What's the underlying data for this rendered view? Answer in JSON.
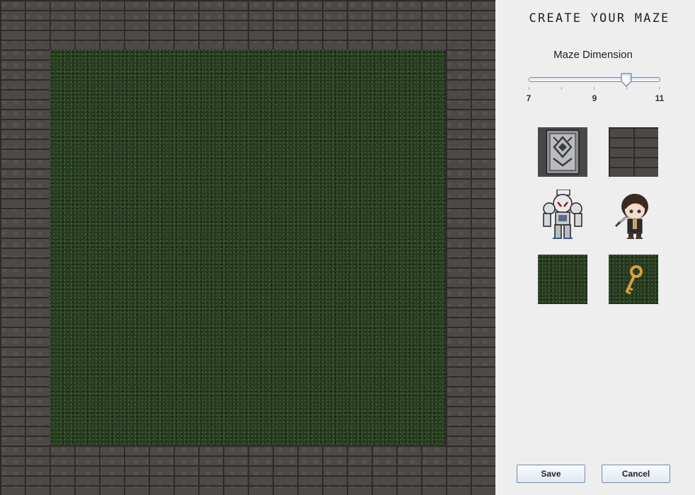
{
  "panel": {
    "title": "CREATE YOUR MAZE",
    "dimension_label": "Maze Dimension"
  },
  "slider": {
    "min": 7,
    "max": 11,
    "value": 10,
    "tick_labels": [
      "7",
      "9",
      "11"
    ]
  },
  "palette": [
    {
      "name": "door-tile",
      "icon": "ornate-door-icon"
    },
    {
      "name": "wall-tile",
      "icon": "brick-wall-icon"
    },
    {
      "name": "enemy-tile",
      "icon": "robot-enemy-icon"
    },
    {
      "name": "player-tile",
      "icon": "hero-with-sword-icon"
    },
    {
      "name": "floor-tile",
      "icon": "grass-floor-icon"
    },
    {
      "name": "key-tile",
      "icon": "golden-key-icon"
    }
  ],
  "buttons": {
    "save": "Save",
    "cancel": "Cancel"
  },
  "colors": {
    "wall": "#4c4a48",
    "floor": "#263b20",
    "panel_bg": "#eeeeee"
  }
}
